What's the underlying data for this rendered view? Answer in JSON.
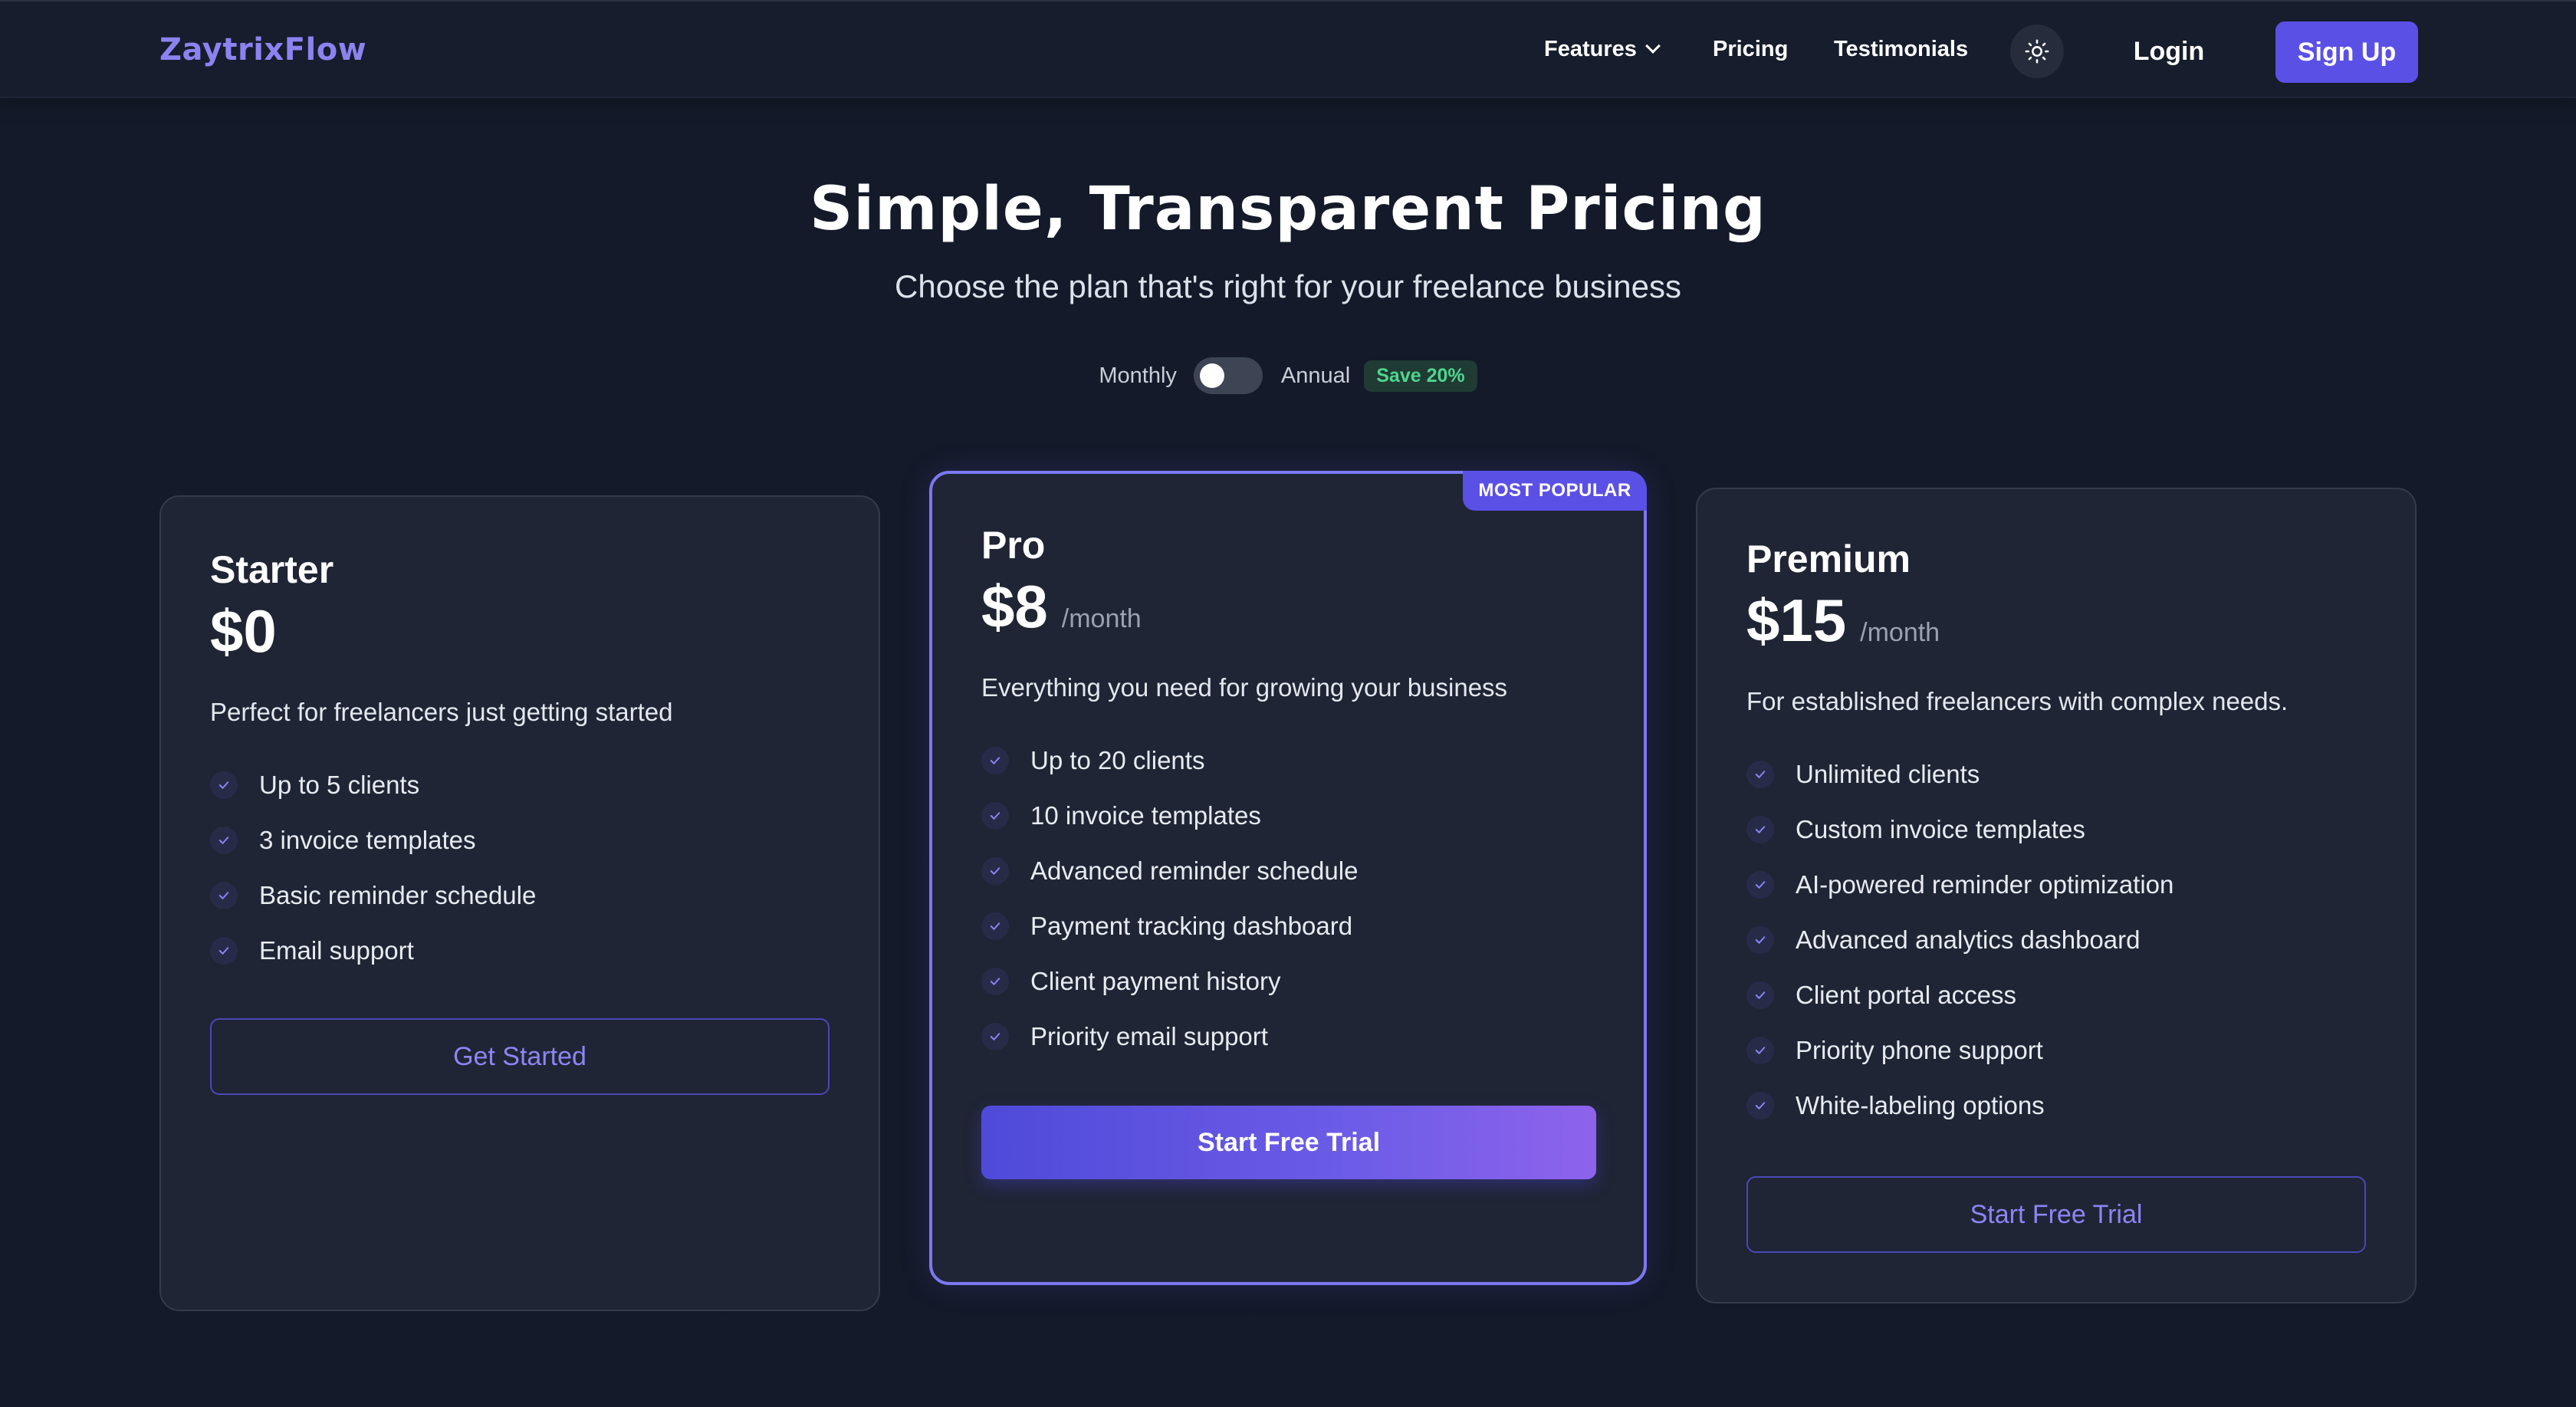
{
  "nav": {
    "logo": "ZaytrixFlow",
    "features": "Features",
    "pricing": "Pricing",
    "testimonials": "Testimonials",
    "login": "Login",
    "signup": "Sign Up"
  },
  "hero": {
    "title": "Simple, Transparent Pricing",
    "subtitle": "Choose the plan that's right for your freelance business"
  },
  "billing": {
    "monthly": "Monthly",
    "annual": "Annual",
    "save": "Save 20%",
    "annual_selected": false
  },
  "plans": [
    {
      "name": "Starter",
      "price": "$0",
      "period": "",
      "description": "Perfect for freelancers just getting started",
      "features": [
        "Up to 5 clients",
        "3 invoice templates",
        "Basic reminder schedule",
        "Email support"
      ],
      "cta": "Get Started"
    },
    {
      "name": "Pro",
      "badge": "MOST POPULAR",
      "price": "$8",
      "period": "/month",
      "description": "Everything you need for growing your business",
      "features": [
        "Up to 20 clients",
        "10 invoice templates",
        "Advanced reminder schedule",
        "Payment tracking dashboard",
        "Client payment history",
        "Priority email support"
      ],
      "cta": "Start Free Trial"
    },
    {
      "name": "Premium",
      "price": "$15",
      "period": "/month",
      "description": "For established freelancers with complex needs.",
      "features": [
        "Unlimited clients",
        "Custom invoice templates",
        "AI-powered reminder optimization",
        "Advanced analytics dashboard",
        "Client portal access",
        "Priority phone support",
        "White-labeling options"
      ],
      "cta": "Start Free Trial"
    }
  ],
  "colors": {
    "background": "#141a29",
    "card": "#1f2534",
    "accent": "#5b50e6",
    "accent_text": "#8b86f5",
    "save_badge_text": "#4fd58f"
  },
  "icons": {
    "features_dropdown": "chevron-down-icon",
    "theme_toggle": "sun-icon",
    "feature_check": "check-icon"
  }
}
